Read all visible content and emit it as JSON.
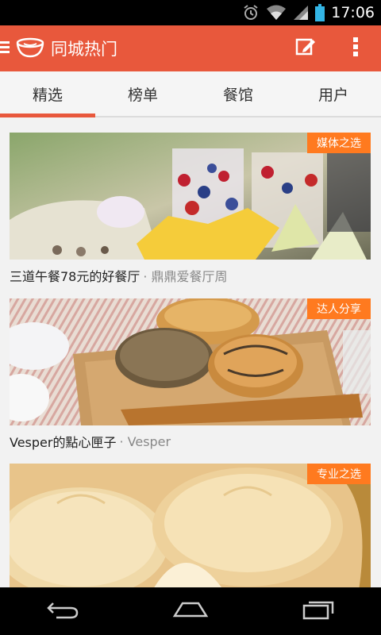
{
  "status_bar": {
    "time": "17:06",
    "icons": [
      "alarm-icon",
      "wifi-icon",
      "signal-icon",
      "battery-icon"
    ]
  },
  "app_bar": {
    "title": "同城热门",
    "logo_icon": "bowl-icon",
    "actions": [
      "compose-icon",
      "overflow-menu-icon"
    ],
    "color": "#e8583c"
  },
  "tabs": [
    {
      "label": "精选",
      "active": true
    },
    {
      "label": "榜单",
      "active": false
    },
    {
      "label": "餐馆",
      "active": false
    },
    {
      "label": "用户",
      "active": false
    }
  ],
  "feed": {
    "items": [
      {
        "tag": "媒体之选",
        "title": "三道午餐78元的好餐厅",
        "meta": "· 鼎鼎爱餐厅周"
      },
      {
        "tag": "达人分享",
        "title": "Vesper的點心匣子",
        "meta": "· Vesper"
      },
      {
        "tag": "专业之选",
        "title": "",
        "meta": ""
      }
    ],
    "tag_color": "#ff7a1f"
  },
  "nav_bar": {
    "buttons": [
      "back-icon",
      "home-icon",
      "recents-icon"
    ]
  }
}
